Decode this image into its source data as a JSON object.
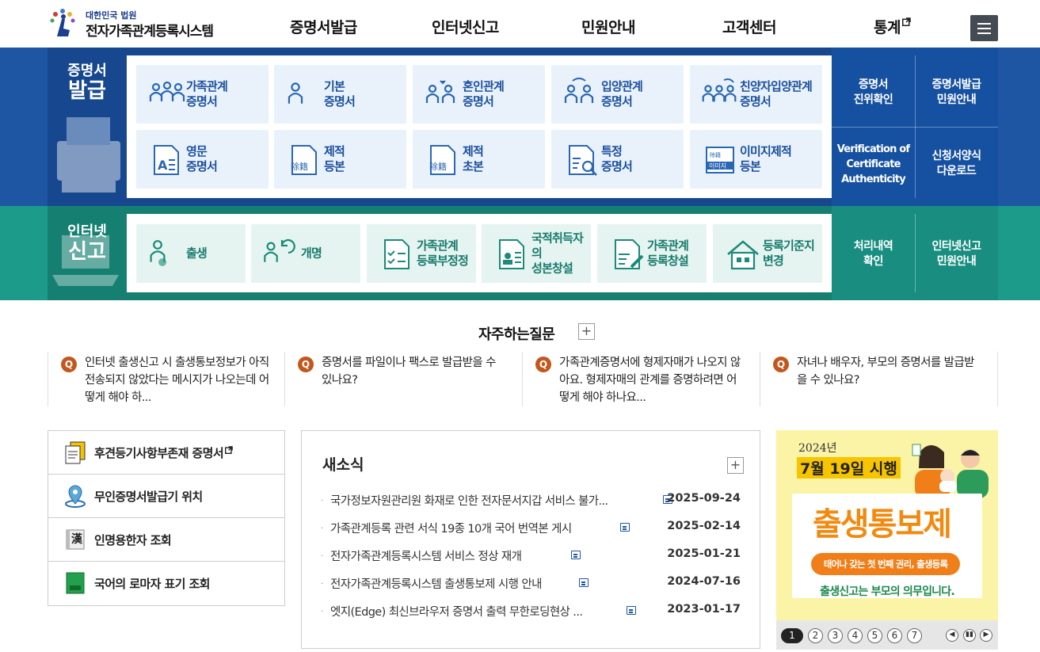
{
  "header": {
    "logo_small": "대한민국 법원",
    "logo_big": "전자가족관계등록시스템",
    "nav": [
      "증명서발급",
      "인터넷신고",
      "민원안내",
      "고객센터",
      "통계"
    ],
    "nav_external_icon": "external-link-icon",
    "menu_icon": "hamburger-icon"
  },
  "certificate": {
    "section_small": "증명서",
    "section_big": "발급",
    "tiles": [
      {
        "label": "가족관계\n증명서",
        "icon": "family-icon"
      },
      {
        "label": "기본\n증명서",
        "icon": "person-icon"
      },
      {
        "label": "혼인관계\n증명서",
        "icon": "couple-heart-icon"
      },
      {
        "label": "입양관계\n증명서",
        "icon": "adoption-icon"
      },
      {
        "label": "친양자입양관계\n증명서",
        "icon": "family-adoption-icon"
      },
      {
        "label": "영문\n증명서",
        "icon": "english-doc-icon"
      },
      {
        "label": "제적\n등본",
        "icon": "removed-register-icon"
      },
      {
        "label": "제적\n초본",
        "icon": "removed-register-icon"
      },
      {
        "label": "특정\n증명서",
        "icon": "search-doc-icon"
      },
      {
        "label": "이미지제적\n등본",
        "icon": "image-register-icon"
      }
    ],
    "side_links": [
      "증명서\n진위확인",
      "증명서발급\n민원안내",
      "Verification of\nCertificate\nAuthenticity",
      "신청서양식\n다운로드"
    ]
  },
  "report": {
    "section_small": "인터넷",
    "section_big": "신고",
    "tiles": [
      {
        "label": "출생",
        "icon": "baby-icon"
      },
      {
        "label": "개명",
        "icon": "rename-icon"
      },
      {
        "label": "가족관계\n등록부정정",
        "icon": "checklist-icon"
      },
      {
        "label": "국적취득자의\n성본창설",
        "icon": "id-doc-icon"
      },
      {
        "label": "가족관계\n등록창설",
        "icon": "doc-pen-icon"
      },
      {
        "label": "등록기준지\n변경",
        "icon": "house-icon"
      }
    ],
    "side_links": [
      "처리내역\n확인",
      "인터넷신고\n민원안내"
    ]
  },
  "faq": {
    "title": "자주하는질문",
    "more": "+",
    "badge": "Q",
    "items": [
      "인터넷 출생신고 시 출생통보정보가 아직 전송되지 않았다는 메시지가 나오는데 어떻게 해야 하...",
      "증명서를 파일이나 팩스로 발급받을 수 있나요?",
      "가족관계증명서에 형제자매가 나오지 않아요. 형제자매의 관계를 증명하려면 어떻게 해야 하나요...",
      "자녀나 배우자, 부모의 증명서를 발급받을 수 있나요?"
    ]
  },
  "quick_links": [
    {
      "label": "후견등기사항부존재 증명서",
      "icon": "document-icon",
      "external": true
    },
    {
      "label": "무인증명서발급기 위치",
      "icon": "location-pin-icon",
      "external": false
    },
    {
      "label": "인명용한자 조회",
      "icon": "hanja-book-icon",
      "external": false
    },
    {
      "label": "국어의 로마자 표기 조회",
      "icon": "green-book-icon",
      "external": false
    }
  ],
  "news": {
    "title": "새소식",
    "more": "+",
    "items": [
      {
        "title": "국가정보자원관리원 화재로 인한 전자문서지갑 서비스 불가...",
        "date": "2025-09-24"
      },
      {
        "title": "가족관계등록 관련 서식 19종 10개 국어 번역본 게시",
        "date": "2025-02-14"
      },
      {
        "title": "전자가족관계등록시스템 서비스 정상 재개",
        "date": "2025-01-21"
      },
      {
        "title": "전자가족관계등록시스템 출생통보제 시행 안내",
        "date": "2024-07-16"
      },
      {
        "title": "엣지(Edge) 최신브라우저 증명서 출력 무한로딩현상 ...",
        "date": "2023-01-17"
      }
    ]
  },
  "banner": {
    "year": "2024년",
    "date": "7월 19일 시행",
    "title": "출생통보제",
    "pill": "태어나 갖는 첫 번째 권리, 출생등록",
    "bottom": "출생신고는 부모의 의무입니다.",
    "colors": {
      "bg": "#fbf3a6",
      "accent": "#f07f1a",
      "title": "#f28a10"
    }
  },
  "pager": {
    "pages": [
      "1",
      "2",
      "3",
      "4",
      "5",
      "6",
      "7"
    ],
    "active": "1",
    "controls": [
      "prev-icon",
      "pause-icon",
      "next-icon"
    ]
  },
  "colors": {
    "blue": "#1e56a4",
    "green": "#1c9a8a",
    "faq_badge": "#c2581d"
  }
}
